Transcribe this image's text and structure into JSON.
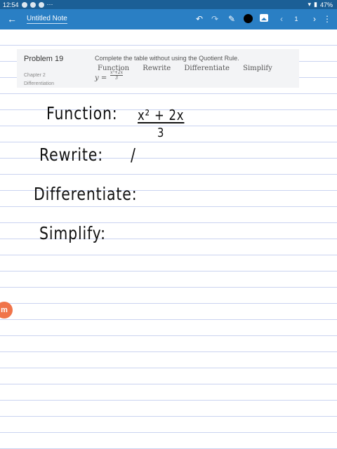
{
  "status_bar": {
    "time": "12:54",
    "battery": "47%",
    "more": "⋯"
  },
  "toolbar": {
    "back_icon": "←",
    "title": "Untitled Note",
    "undo_icon": "↶",
    "redo_icon": "↷",
    "pen_icon": "✎",
    "prev_icon": "‹",
    "page_number": "1",
    "next_icon": "›",
    "more_icon": "⋮"
  },
  "problem": {
    "title": "Problem 19",
    "chapter": "Chapter 2",
    "section": "Differentiation",
    "instruction": "Complete the table without using the Quotient Rule.",
    "columns": [
      "Function",
      "Rewrite",
      "Differentiate",
      "Simplify"
    ],
    "equation_lhs": "y =",
    "numerator": "x²+2x",
    "denominator": "3"
  },
  "handwriting": {
    "function_label": "Function:",
    "function_num": "x² + 2x",
    "function_den": "3",
    "rewrite_label": "Rewrite:",
    "rewrite_mark": "/",
    "differentiate_label": "Differentiate:",
    "simplify_label": "Simplify:"
  },
  "logo_text": "m",
  "colors": {
    "toolbar": "#2a7fc4",
    "status_bar": "#1b5f96",
    "rule_line": "#cad3f0",
    "logo": "#f0744a"
  }
}
